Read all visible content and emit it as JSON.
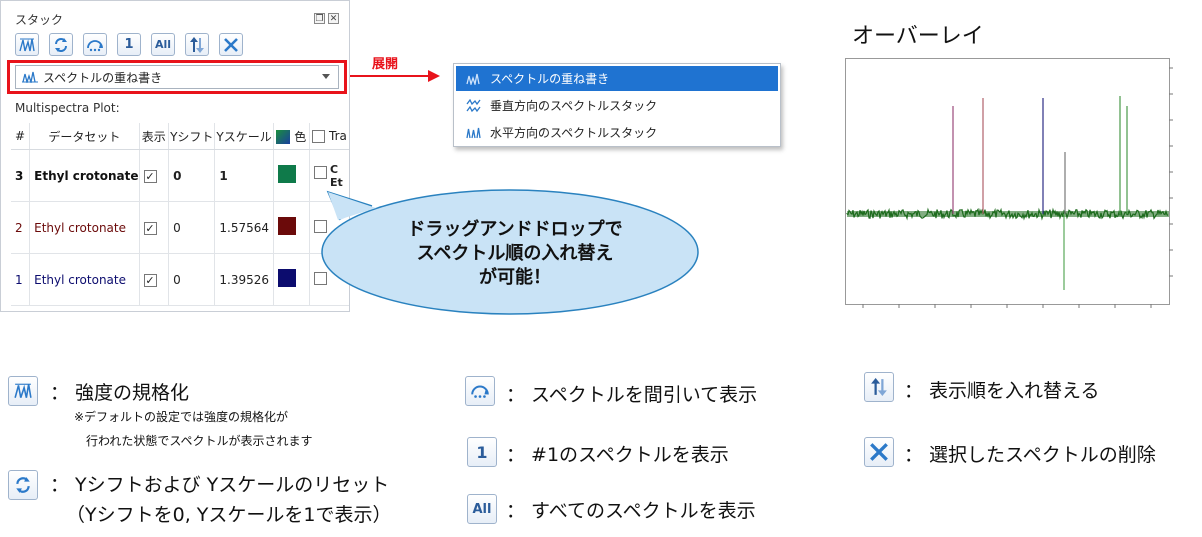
{
  "panel": {
    "title": "スタック",
    "toolbar": {
      "normalize_icon": "normalize-intensity-icon",
      "reset_icon": "reset-icon",
      "thin_icon": "thin-out-icon",
      "show_first_label": "1",
      "show_all_label": "All",
      "reorder_icon": "reorder-icon",
      "delete_icon": "delete-icon"
    },
    "dropdown_value": "スペクトルの重ね書き",
    "multispectra_label": "Multispectra Plot:",
    "columns": [
      "#",
      "データセット",
      "表示",
      "Yシフト",
      "Yスケール",
      "色",
      "Tra"
    ],
    "rows": [
      {
        "index": "3",
        "dataset": "Ethyl crotonate",
        "shown": "✓",
        "yshift": "0",
        "yscale": "1",
        "color": "#0f7a4a",
        "bold": true,
        "tail": "C\nEt"
      },
      {
        "index": "2",
        "dataset": "Ethyl crotonate",
        "shown": "✓",
        "yshift": "0",
        "yscale": "1.57564",
        "color": "#6b0a0a",
        "bold": false,
        "tail": ""
      },
      {
        "index": "1",
        "dataset": "Ethyl crotonate",
        "shown": "✓",
        "yshift": "0",
        "yscale": "1.39526",
        "color": "#0c0c6e",
        "bold": false,
        "tail": ""
      }
    ]
  },
  "expand_label": "展開",
  "menu": {
    "items": [
      {
        "label": "スペクトルの重ね書き",
        "selected": true
      },
      {
        "label": "垂直方向のスペクトルスタック",
        "selected": false
      },
      {
        "label": "水平方向のスペクトルスタック",
        "selected": false
      }
    ]
  },
  "callout": {
    "line1": "ドラッグアンドドロップで",
    "line2": "スペクトル順の入れ替え",
    "line3": "が可能！"
  },
  "overlay": {
    "title": "オーバーレイ"
  },
  "legend": {
    "normalize": "：  強度の規格化",
    "normalize_note1": "※デフォルトの設定では強度の規格化が",
    "normalize_note2": "行われた状態でスペクトルが表示されます",
    "reset_line1": "：  Yシフトおよび Yスケールのリセット",
    "reset_line2": "（Yシフトを0, Yスケールを1で表示）",
    "thin": "：  スペクトルを間引いて表示",
    "show_first": "：  #1のスペクトルを表示",
    "show_all": "：  すべてのスペクトルを表示",
    "reorder": "：  表示順を入れ替える",
    "delete": "：  選択したスペクトルの削除",
    "icon_1": "1",
    "icon_all": "All"
  },
  "colors": {
    "accent_red": "#e8131b",
    "menu_selected": "#1f73d1",
    "callout_fill": "#c9e3f6",
    "trace_green": "#1e6b1e"
  }
}
